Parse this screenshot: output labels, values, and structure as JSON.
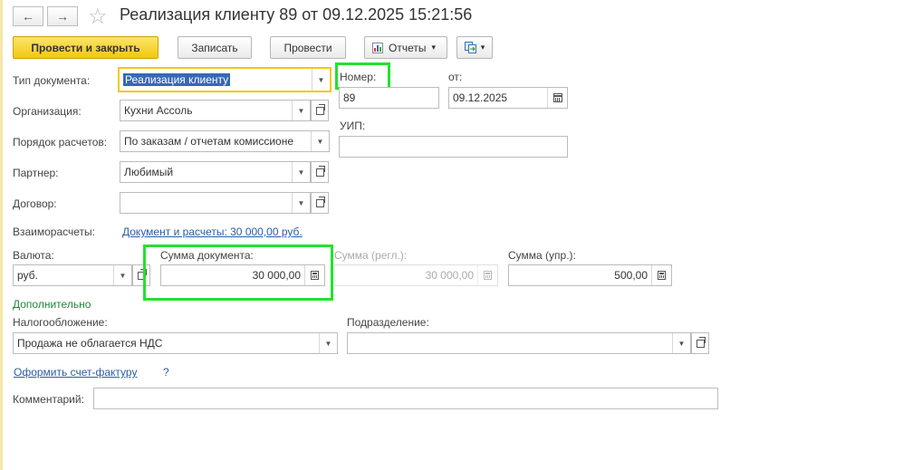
{
  "window": {
    "title": "Реализация клиенту 89 от 09.12.2025 15:21:56",
    "back_icon": "←",
    "forward_icon": "→",
    "star_icon": "☆"
  },
  "toolbar": {
    "post_and_close_label": "Провести и закрыть",
    "save_label": "Записать",
    "post_label": "Провести",
    "reports_label": "Отчеты",
    "dropdown_glyph": "▾"
  },
  "form": {
    "doc_type": {
      "label": "Тип документа:",
      "value": "Реализация клиенту"
    },
    "number": {
      "label": "Номер:",
      "value": "89"
    },
    "date": {
      "label": "от:",
      "value": "09.12.2025"
    },
    "organization": {
      "label": "Организация:",
      "value": "Кухни Ассоль"
    },
    "uip": {
      "label": "УИП:",
      "value": ""
    },
    "settlement_order": {
      "label": "Порядок расчетов:",
      "value": "По заказам / отчетам комиссионе"
    },
    "partner": {
      "label": "Партнер:",
      "value": "Любимый"
    },
    "contract": {
      "label": "Договор:",
      "value": ""
    },
    "mutual_settlements": {
      "label": "Взаиморасчеты:",
      "link": "Документ и расчеты: 30 000,00 руб."
    },
    "currency": {
      "label": "Валюта:",
      "value": "руб."
    },
    "doc_sum": {
      "label": "Сумма документа:",
      "value": "30 000,00"
    },
    "sum_reg": {
      "label": "Сумма (регл.):",
      "value": "30 000,00"
    },
    "sum_mgmt": {
      "label": "Сумма (упр.):",
      "value": "500,00"
    },
    "additional_label": "Дополнительно",
    "taxation": {
      "label": "Налогообложение:",
      "value": "Продажа не облагается НДС"
    },
    "department": {
      "label": "Подразделение:",
      "value": ""
    },
    "invoice_link": "Оформить счет-фактуру",
    "help_link": "?",
    "comment": {
      "label": "Комментарий:",
      "value": ""
    }
  },
  "colors": {
    "highlight": "#22e22e",
    "primary_button": "#f2c811",
    "link": "#2a5da8",
    "section_green": "#1b8a3a"
  }
}
